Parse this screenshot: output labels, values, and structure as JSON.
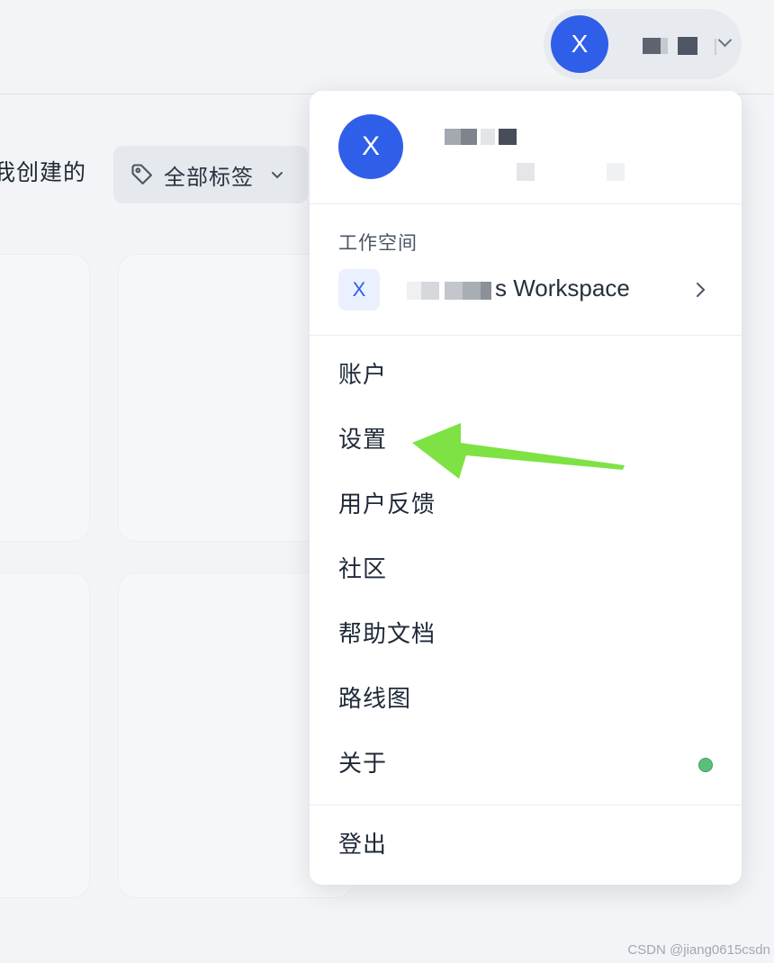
{
  "header": {
    "avatar_letter": "X",
    "user_name": ""
  },
  "filters": {
    "created_by_me": "我创建的",
    "tags_button": "全部标签"
  },
  "menu": {
    "avatar_letter": "X",
    "user_name": "",
    "workspace_section_label": "工作空间",
    "workspace": {
      "badge_letter": "X",
      "name": "s Workspace"
    },
    "items": [
      {
        "label": "账户"
      },
      {
        "label": "设置"
      },
      {
        "label": "用户反馈"
      },
      {
        "label": "社区"
      },
      {
        "label": "帮助文档"
      },
      {
        "label": "路线图"
      },
      {
        "label": "关于"
      }
    ],
    "logout_label": "登出"
  },
  "annotation": {
    "arrow_color": "#7ee244"
  },
  "watermark": "CSDN @jiang0615csdn",
  "colors": {
    "accent": "#2f5fe8",
    "status_dot": "#58c07a"
  }
}
